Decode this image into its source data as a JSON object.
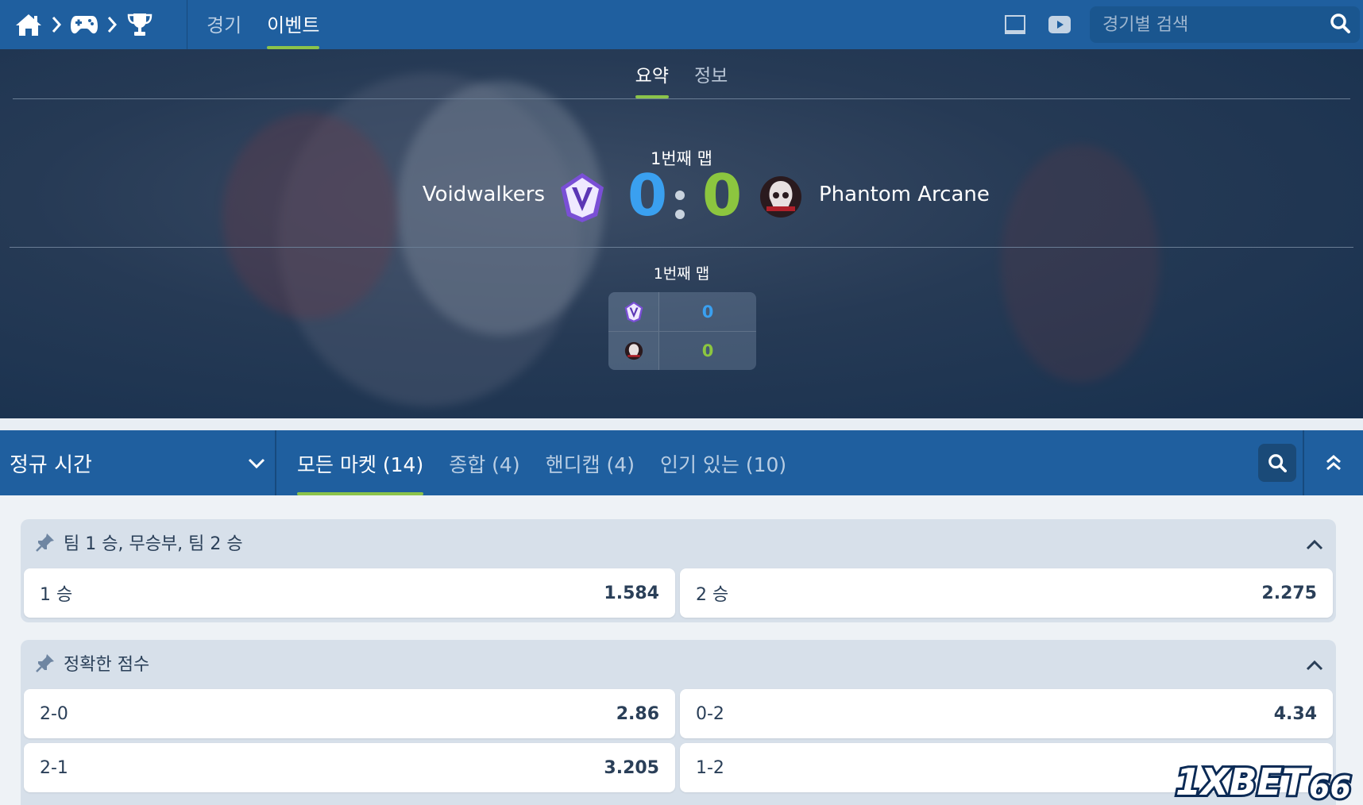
{
  "nav": {
    "breadcrumb_icons": [
      "home-icon",
      "gamepad-icon",
      "trophy-icon"
    ],
    "tabs": [
      {
        "label": "경기",
        "active": false
      },
      {
        "label": "이벤트",
        "active": true
      }
    ],
    "search_placeholder": "경기별 검색"
  },
  "hero": {
    "tabs": [
      {
        "label": "요약",
        "active": true
      },
      {
        "label": "정보",
        "active": false
      }
    ],
    "map_label": "1번째 맵",
    "team1": {
      "name": "Voidwalkers",
      "score": "0",
      "color": "#3aa0f0"
    },
    "team2": {
      "name": "Phantom Arcane",
      "score": "0",
      "color": "#8cc63f"
    },
    "map_table": {
      "title": "1번째 맵",
      "team1_score": "0",
      "team2_score": "0"
    }
  },
  "market_bar": {
    "period": "정규 시간",
    "tabs": [
      {
        "label": "모든 마켓 (14)",
        "active": true
      },
      {
        "label": "종합 (4)",
        "active": false
      },
      {
        "label": "핸디캡 (4)",
        "active": false
      },
      {
        "label": "인기 있는 (10)",
        "active": false
      }
    ]
  },
  "markets": [
    {
      "title": "팀 1 승, 무승부, 팀 2 승",
      "bets": [
        {
          "name": "1 승",
          "odds": "1.584"
        },
        {
          "name": "2 승",
          "odds": "2.275"
        }
      ]
    },
    {
      "title": "정확한 점수",
      "bets": [
        {
          "name": "2-0",
          "odds": "2.86"
        },
        {
          "name": "0-2",
          "odds": "4.34"
        },
        {
          "name": "2-1",
          "odds": "3.205"
        },
        {
          "name": "1-2",
          "odds": ""
        }
      ]
    }
  ],
  "watermark": "1XBET66",
  "colors": {
    "nav_blue": "#1f5f9f",
    "accent_green": "#8bc34a",
    "team1_blue": "#3aa0f0",
    "team2_green": "#8cc63f"
  }
}
